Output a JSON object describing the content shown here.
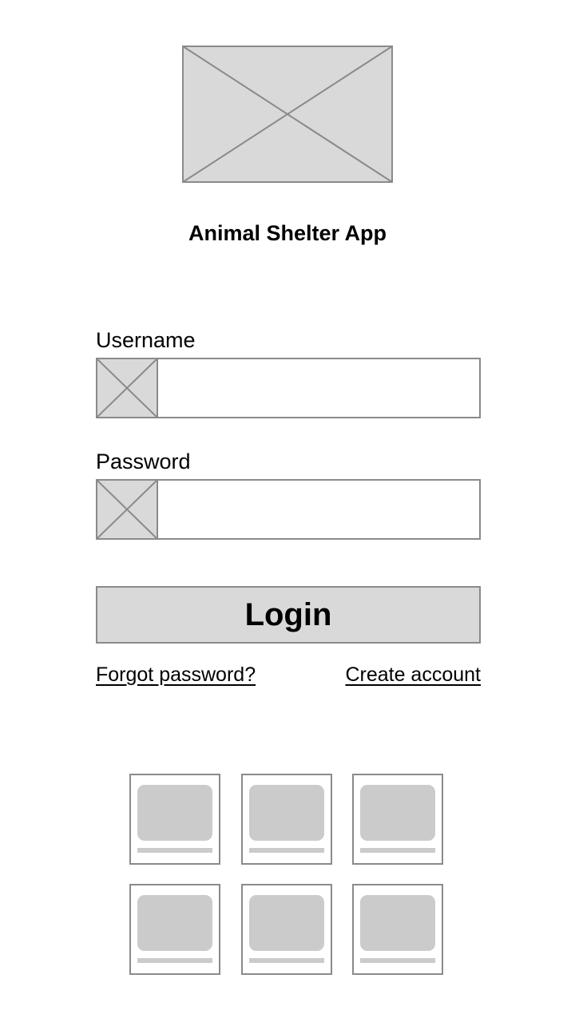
{
  "app": {
    "title": "Animal Shelter App",
    "logo_icon": "image-placeholder-icon"
  },
  "form": {
    "username": {
      "label": "Username",
      "value": "",
      "placeholder": "",
      "icon": "image-placeholder-icon"
    },
    "password": {
      "label": "Password",
      "value": "",
      "placeholder": "",
      "icon": "image-placeholder-icon"
    },
    "login_label": "Login"
  },
  "links": {
    "forgot_password": "Forgot password?",
    "create_account": "Create account"
  },
  "gallery": {
    "tile_count": 6
  },
  "colors": {
    "placeholder_fill": "#d9d9d9",
    "border": "#8a8a8a",
    "tile_fill": "#cccbcb",
    "text": "#000000",
    "background": "#ffffff"
  }
}
